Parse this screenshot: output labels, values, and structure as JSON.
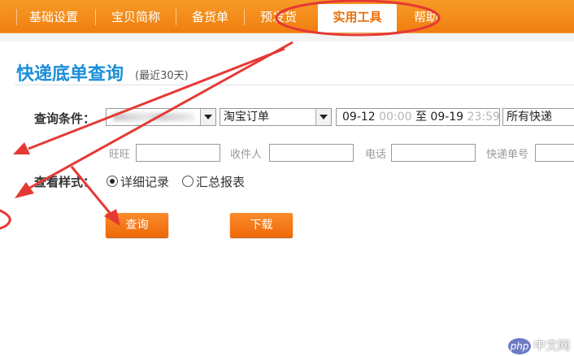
{
  "nav": {
    "items": [
      "基础设置",
      "宝贝简称",
      "备货单",
      "预发货",
      "实用工具",
      "帮助"
    ],
    "active": "实用工具"
  },
  "page": {
    "title": "快递底单查询",
    "subtitle": "(最近30天)"
  },
  "query": {
    "label": "查询条件：",
    "order_type": "淘宝订单",
    "date_from": "09-12",
    "time_from": "00:00",
    "to_label": "至",
    "date_to": "09-19",
    "time_to": "23:59",
    "express": "所有快递"
  },
  "filters": {
    "wangwang": "旺旺",
    "receiver": "收件人",
    "phone": "电话",
    "tracking_no": "快递单号"
  },
  "view": {
    "label": "查看样式：",
    "option1": "详细记录",
    "option2": "汇总报表",
    "selected": "详细记录"
  },
  "buttons": {
    "query": "查询",
    "download": "下载"
  },
  "watermark": {
    "logo": "php",
    "text": "中文网"
  },
  "colors": {
    "nav_bg": "#f08a18",
    "title": "#1b8ed7",
    "button": "#f47a1a",
    "annotation": "#e53935"
  }
}
